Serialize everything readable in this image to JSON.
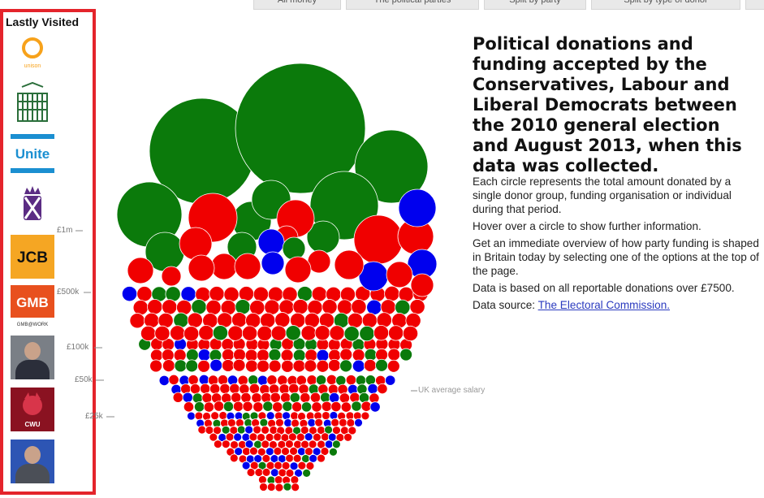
{
  "tabs": [
    "All money",
    "The political parties",
    "Split by party",
    "Split by type of donor"
  ],
  "sidebar": {
    "title": "Lastly Visited",
    "items": [
      {
        "name": "unison-logo",
        "label": "unison",
        "color": "#f7a21b"
      },
      {
        "name": "portcullis-logo"
      },
      {
        "name": "unite-logo",
        "label": "Unite",
        "color": "#1b8fd1"
      },
      {
        "name": "scottish-parliament-logo",
        "color": "#5b2c83"
      },
      {
        "name": "jcb-logo",
        "label": "JCB",
        "color": "#f5a623"
      },
      {
        "name": "gmb-logo",
        "label": "GMB",
        "sublabel": "GMB@WORK",
        "color": "#e8501e"
      },
      {
        "name": "donor-photo-1"
      },
      {
        "name": "cwu-logo",
        "label": "CWU",
        "color": "#8a1221"
      },
      {
        "name": "donor-photo-2"
      }
    ]
  },
  "scale": {
    "labels": [
      "£1m",
      "£500k",
      "£100k",
      "£50k",
      "£25k"
    ],
    "salary_label": "UK average salary"
  },
  "headline": "Political donations and funding accepted by the Conservatives, Labour and Liberal Democrats between the 2010 general election and August 2013, when this data was collected.",
  "info": {
    "p1": "Each circle represents the total amount donated by a single donor group, funding organisation or individual during that period.",
    "p2": "Hover over a circle to show further information.",
    "p3": "Get an immediate overview of how party funding is shaped in Britain today by selecting one of the options at the top of the page.",
    "p4": "Data is based on all reportable donations over £7500.",
    "source_prefix": "Data source:",
    "source_link": "The Electoral Commission."
  },
  "colors": {
    "conservative": "#0b7a0b",
    "labour": "#f00000",
    "libdem": "#0000ee",
    "accent": "#e4242b"
  }
}
